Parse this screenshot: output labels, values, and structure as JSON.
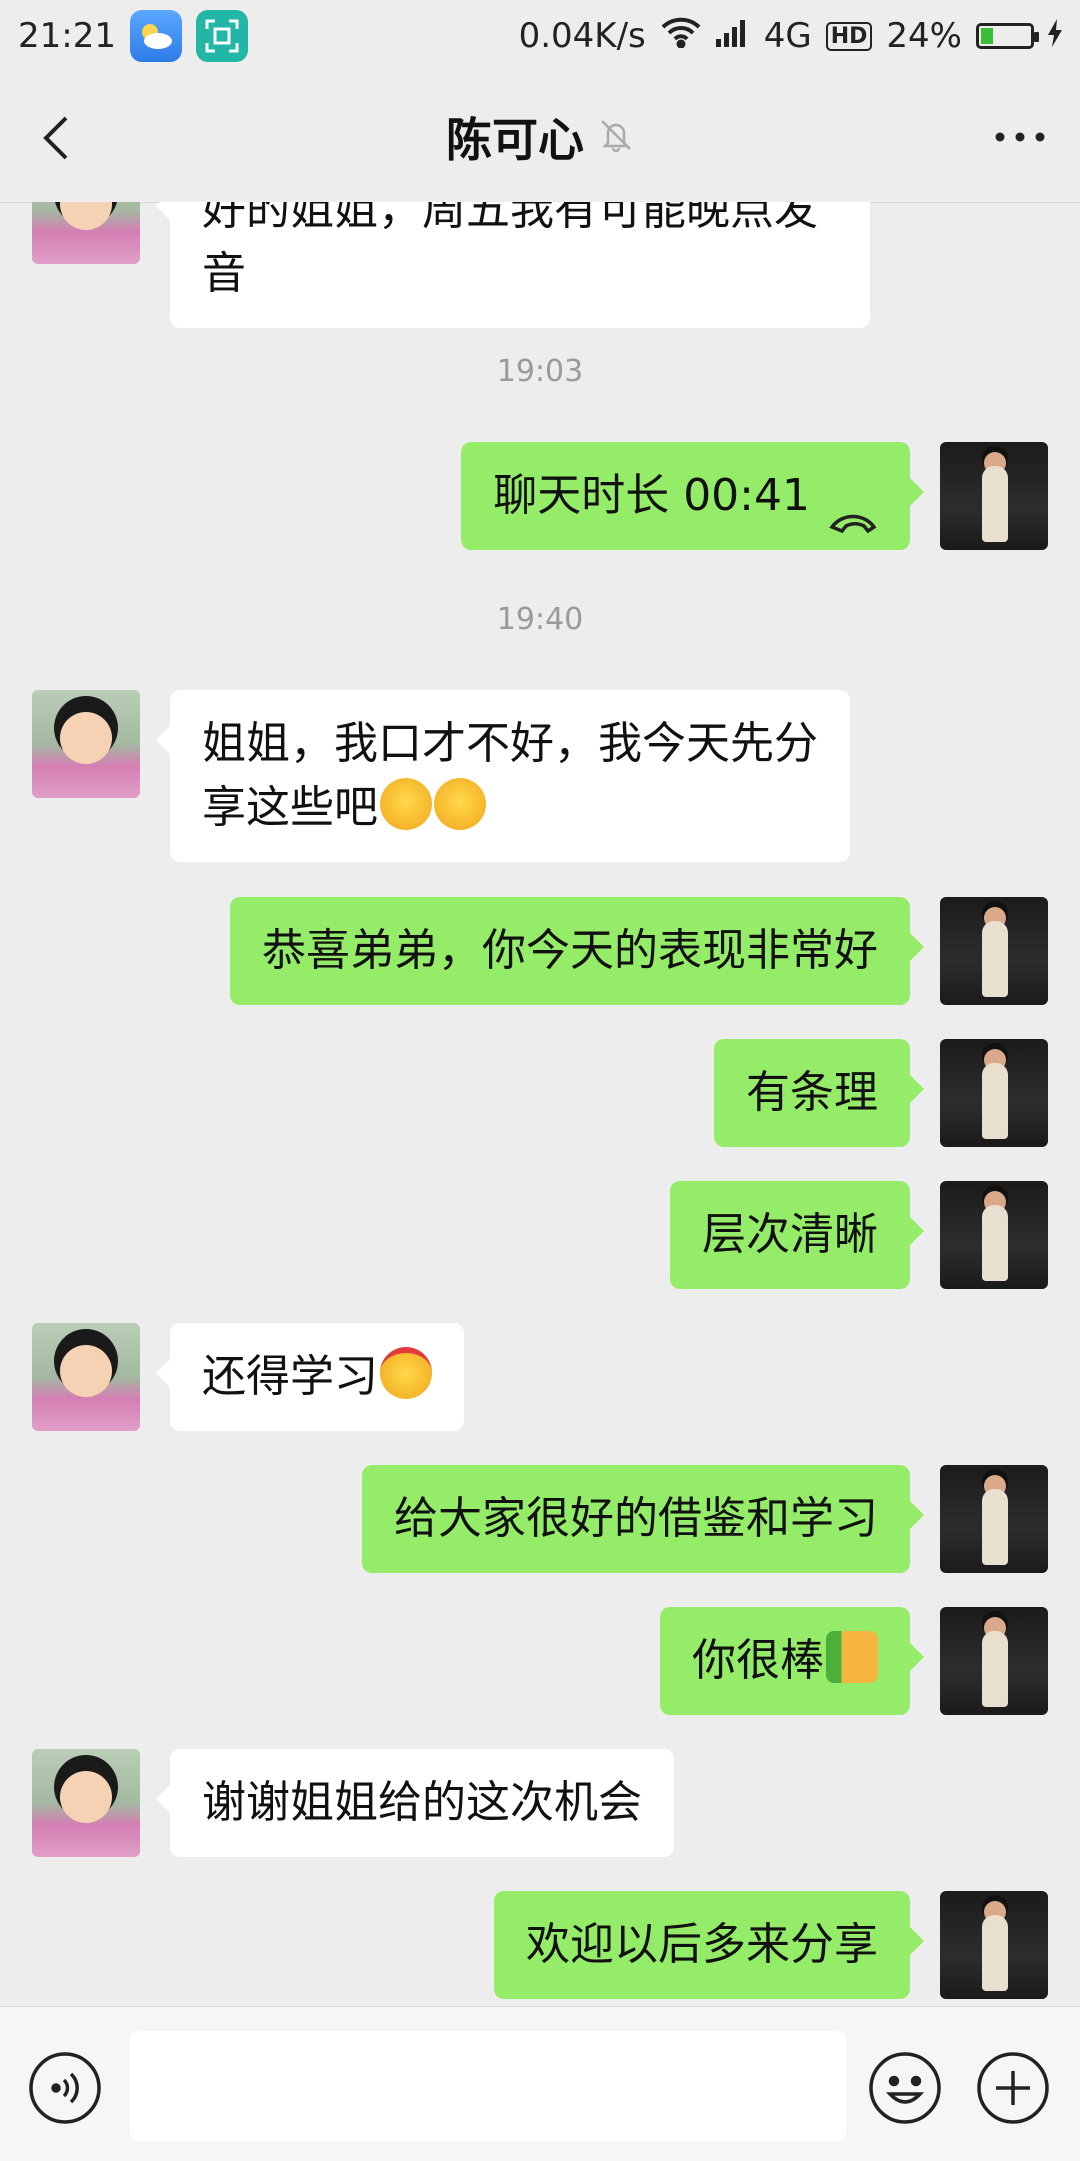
{
  "status_bar": {
    "time": "21:21",
    "net_speed": "0.04K/s",
    "network": "4G",
    "hd": "HD",
    "battery": "24%",
    "battery_level": 0.24
  },
  "header": {
    "title": "陈可心"
  },
  "messages": [
    {
      "side": "left",
      "text": "好的姐姐，周五我有可能晚点发音"
    },
    {
      "time": "19:03"
    },
    {
      "side": "right",
      "text": "聊天时长 00:41"
    },
    {
      "time": "19:40"
    },
    {
      "side": "left",
      "text": "姐姐，我口才不好，我今天先分享这些吧",
      "emoji": [
        "crying-laughing",
        "crying-laughing"
      ]
    },
    {
      "side": "right",
      "text": "恭喜弟弟，你今天的表现非常好"
    },
    {
      "side": "right",
      "text": "有条理"
    },
    {
      "side": "right",
      "text": "层次清晰"
    },
    {
      "side": "left",
      "text": "还得学习",
      "emoji": [
        "thinking-headband"
      ]
    },
    {
      "side": "right",
      "text": "给大家很好的借鉴和学习"
    },
    {
      "side": "right",
      "text": "你很棒",
      "emoji": [
        "thumbs-up"
      ]
    },
    {
      "side": "left",
      "text": "谢谢姐姐给的这次机会"
    },
    {
      "side": "right",
      "text": "欢迎以后多来分享"
    }
  ],
  "colors": {
    "self_bubble": "#95ec69",
    "other_bubble": "#ffffff",
    "background": "#ededed"
  }
}
